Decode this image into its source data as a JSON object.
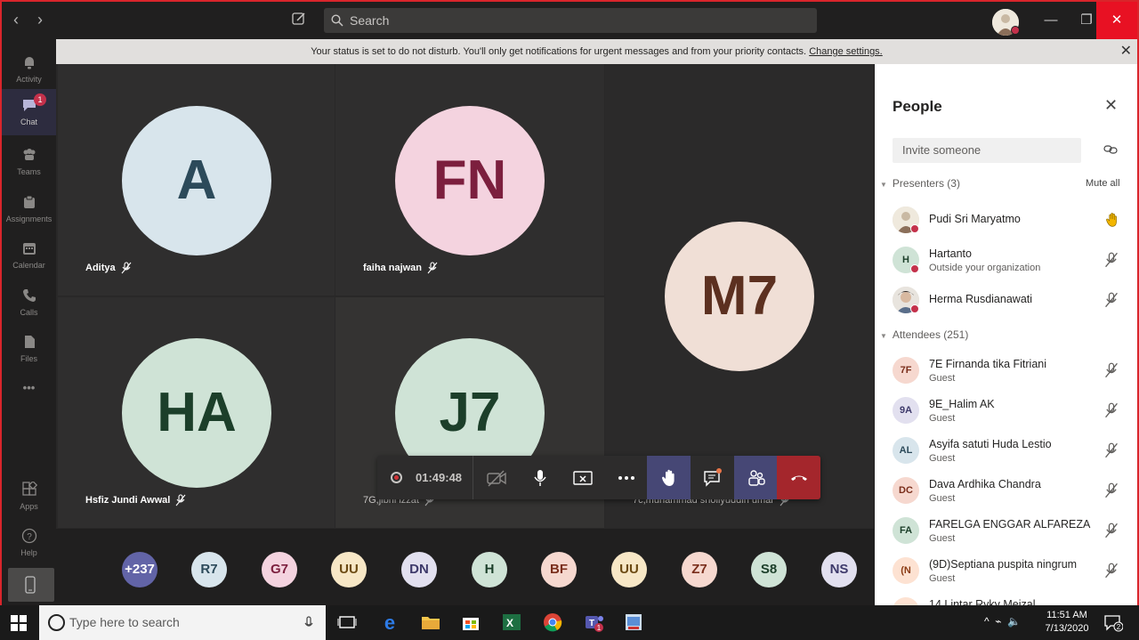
{
  "titlebar": {
    "search_placeholder": "Search",
    "back_icon": "chevron-left-icon",
    "forward_icon": "chevron-right-icon",
    "colors": {
      "close_button": "#e81123"
    }
  },
  "rail": {
    "items": [
      {
        "label": "Activity",
        "icon": "bell-icon"
      },
      {
        "label": "Chat",
        "icon": "chat-icon",
        "badge": "1"
      },
      {
        "label": "Teams",
        "icon": "teams-icon"
      },
      {
        "label": "Assignments",
        "icon": "assignments-icon"
      },
      {
        "label": "Calendar",
        "icon": "calendar-icon"
      },
      {
        "label": "Calls",
        "icon": "phone-icon"
      },
      {
        "label": "Files",
        "icon": "file-icon"
      },
      {
        "label": "•••",
        "icon": "more-icon"
      }
    ],
    "bottom": [
      {
        "label": "Apps",
        "icon": "apps-icon"
      },
      {
        "label": "Help",
        "icon": "help-icon"
      }
    ]
  },
  "banner": {
    "text": "Your status is set to do not disturb. You'll only get notifications for urgent messages and from your priority contacts.",
    "link": "Change settings."
  },
  "stage": {
    "tiles": [
      {
        "initials": "A",
        "name": "Aditya",
        "bg": "#d8e5ec",
        "fg": "#2c4a5a"
      },
      {
        "initials": "FN",
        "name": "faiha najwan",
        "bg": "#f4d3df",
        "fg": "#7c1f3e"
      },
      {
        "initials": "HA",
        "name": "Hsfiz Jundi Awwal",
        "bg": "#cfe3d6",
        "fg": "#1c3f2a"
      },
      {
        "initials": "J7",
        "name": "7G,jibril izzat",
        "bg": "#cfe3d6",
        "fg": "#1c3f2a"
      },
      {
        "initials": "M7",
        "name": "7c,muhammad shollyuddin umar",
        "bg": "#f0dfd6",
        "fg": "#5c3020"
      }
    ],
    "controls": {
      "timer": "01:49:48"
    }
  },
  "strip": {
    "avatars": [
      {
        "label": "+237",
        "bg": "#6264a7",
        "fg": "#ffffff"
      },
      {
        "label": "R7",
        "bg": "#d8e5ec",
        "fg": "#2c4a5a"
      },
      {
        "label": "G7",
        "bg": "#f4d3df",
        "fg": "#7c1f3e"
      },
      {
        "label": "UU",
        "bg": "#f7e7c6",
        "fg": "#6b4a12"
      },
      {
        "label": "DN",
        "bg": "#e2e0ef",
        "fg": "#3e3a6b"
      },
      {
        "label": "H",
        "bg": "#cfe3d6",
        "fg": "#1c3f2a"
      },
      {
        "label": "BF",
        "bg": "#f6d8cf",
        "fg": "#7a2e1b"
      },
      {
        "label": "UU",
        "bg": "#f7e7c6",
        "fg": "#6b4a12"
      },
      {
        "label": "Z7",
        "bg": "#f6d8cf",
        "fg": "#7a2e1b"
      },
      {
        "label": "S8",
        "bg": "#cfe3d6",
        "fg": "#1c3f2a"
      },
      {
        "label": "NS",
        "bg": "#e2e0ef",
        "fg": "#3e3a6b"
      }
    ]
  },
  "people": {
    "title": "People",
    "invite_placeholder": "Invite someone",
    "presenters_label": "Presenters (3)",
    "mute_all": "Mute all",
    "attendees_label": "Attendees (251)",
    "presenters": [
      {
        "name": "Pudi Sri Maryatmo",
        "sub": "",
        "initials": "",
        "photo": true,
        "badge": true,
        "icon": "raised-hand-icon"
      },
      {
        "name": "Hartanto",
        "sub": "Outside your organization",
        "initials": "H",
        "bg": "#cfe3d6",
        "fg": "#1c3f2a",
        "badge": true,
        "icon": "mic-off-icon"
      },
      {
        "name": "Herma Rusdianawati",
        "sub": "",
        "initials": "",
        "photo": true,
        "badge": true,
        "icon": "mic-off-icon"
      }
    ],
    "attendees": [
      {
        "name": "7E Firnanda tika Fitriani",
        "sub": "Guest",
        "initials": "7F",
        "bg": "#f6d8cf",
        "fg": "#7a2e1b"
      },
      {
        "name": "9E_Halim AK",
        "sub": "Guest",
        "initials": "9A",
        "bg": "#e2e0ef",
        "fg": "#3e3a6b"
      },
      {
        "name": "Asyifa satuti Huda Lestio",
        "sub": "Guest",
        "initials": "AL",
        "bg": "#d8e5ec",
        "fg": "#2c4a5a"
      },
      {
        "name": "Dava Ardhika Chandra",
        "sub": "Guest",
        "initials": "DC",
        "bg": "#f6d8cf",
        "fg": "#7a2e1b"
      },
      {
        "name": "FARELGA ENGGAR ALFAREZA",
        "sub": "Guest",
        "initials": "FA",
        "bg": "#cfe3d6",
        "fg": "#1c3f2a"
      },
      {
        "name": "(9D)Septiana puspita ningrum",
        "sub": "Guest",
        "initials": "(N",
        "bg": "#fde2d2",
        "fg": "#8a3a12"
      },
      {
        "name": "14.Lintar Ryky Meizal",
        "sub": "",
        "initials": "",
        "bg": "#fde2d2",
        "fg": "#8a3a12"
      }
    ]
  },
  "taskbar": {
    "search_placeholder": "Type here to search",
    "time": "11:51 AM",
    "date": "7/13/2020",
    "notification_count": "2"
  }
}
